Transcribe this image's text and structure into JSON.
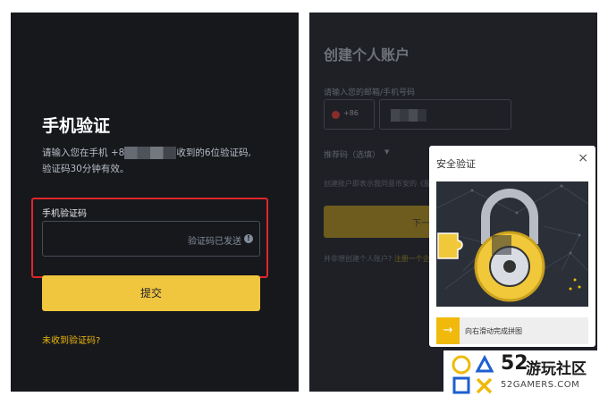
{
  "left_panel": {
    "title": "手机验证",
    "desc_prefix": "请输入您在手机 +8",
    "desc_suffix": "收到的6位验证码,",
    "desc_line2": "验证码30分钟有效。",
    "code_label": "手机验证码",
    "code_status": "验证码已发送",
    "submit_label": "提交",
    "no_code_link": "未收到验证码?",
    "colors": {
      "accent": "#f0c63f",
      "highlight_border": "#e0262b",
      "link": "#f0b90b"
    }
  },
  "right_panel": {
    "title": "创建个人账户",
    "phone_label": "请输入您的邮箱/手机号码",
    "dial_code": "+86",
    "referral_label": "推荐码（选填）",
    "terms_text": "创建账户即表示我同意币安的《服务",
    "next_label": "下一步",
    "register_text": "并非想创建个人账户?",
    "register_link": "注册一个企"
  },
  "modal": {
    "title": "安全验证",
    "close": "×",
    "slider_arrow": "→",
    "slider_text": "向右滑动完成拼图"
  },
  "watermark": {
    "number": "52",
    "name": "游玩社区",
    "site": "52GAMERS.COM"
  },
  "icons": [
    "info-icon",
    "chevron-down-icon",
    "close-icon",
    "arrow-right-icon",
    "padlock-icon"
  ]
}
